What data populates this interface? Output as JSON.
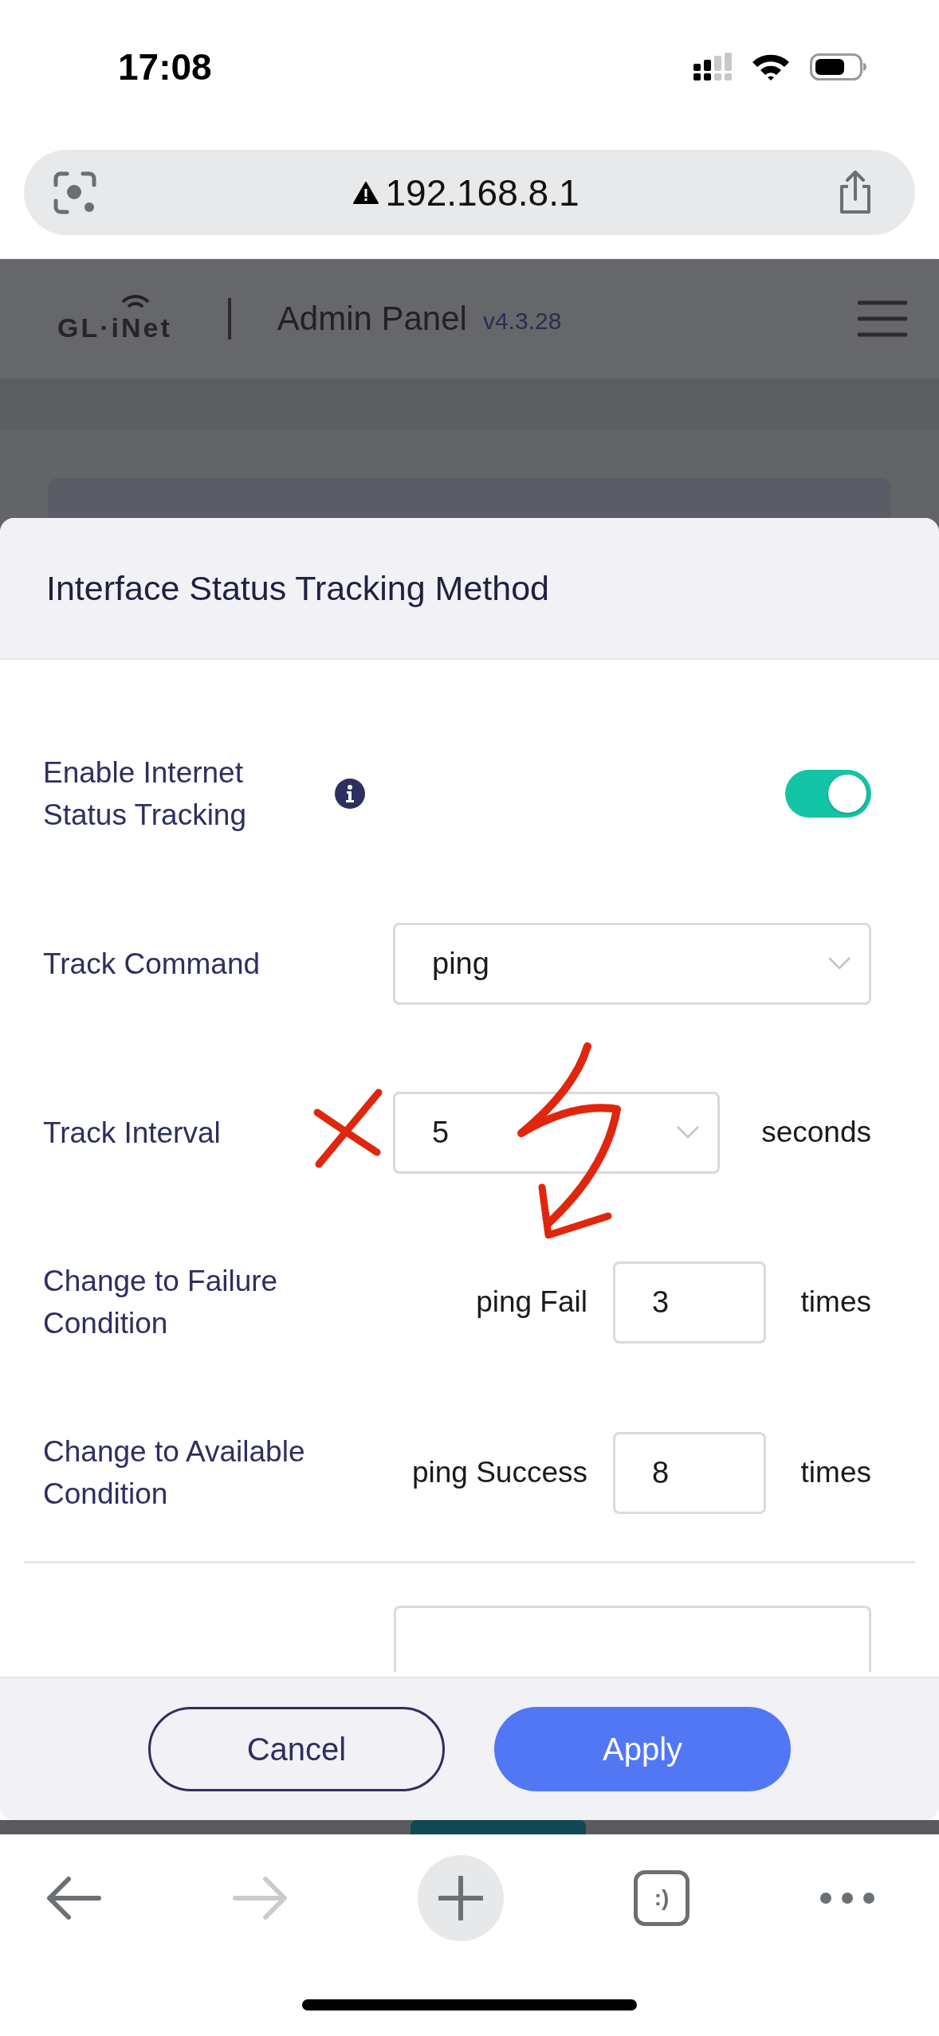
{
  "status_bar": {
    "time": "17:08"
  },
  "address_bar": {
    "url": "192.168.8.1",
    "insecure": true
  },
  "app_header": {
    "logo": "GL·iNet",
    "title": "Admin Panel",
    "version": "v4.3.28"
  },
  "dialog": {
    "title": "Interface Status Tracking Method",
    "fields": [
      {
        "kind": "toggle",
        "label": "Enable Internet Status Tracking",
        "info": true,
        "on": true
      },
      {
        "kind": "select",
        "label": "Track Command",
        "value": "ping"
      },
      {
        "kind": "select",
        "label": "Track Interval",
        "value": "5",
        "unit": "seconds"
      },
      {
        "kind": "count",
        "label": "Change to Failure Condition",
        "prefix": "ping Fail",
        "value": "3",
        "unit": "times"
      },
      {
        "kind": "count",
        "label": "Change to Available Condition",
        "prefix": "ping Success",
        "value": "8",
        "unit": "times"
      }
    ],
    "buttons": [
      {
        "label": "Cancel",
        "kind": "secondary"
      },
      {
        "label": "Apply",
        "kind": "primary"
      }
    ]
  },
  "browser_toolbar": {
    "back_enabled": true,
    "forward_enabled": false,
    "tabs_label": ":)"
  }
}
